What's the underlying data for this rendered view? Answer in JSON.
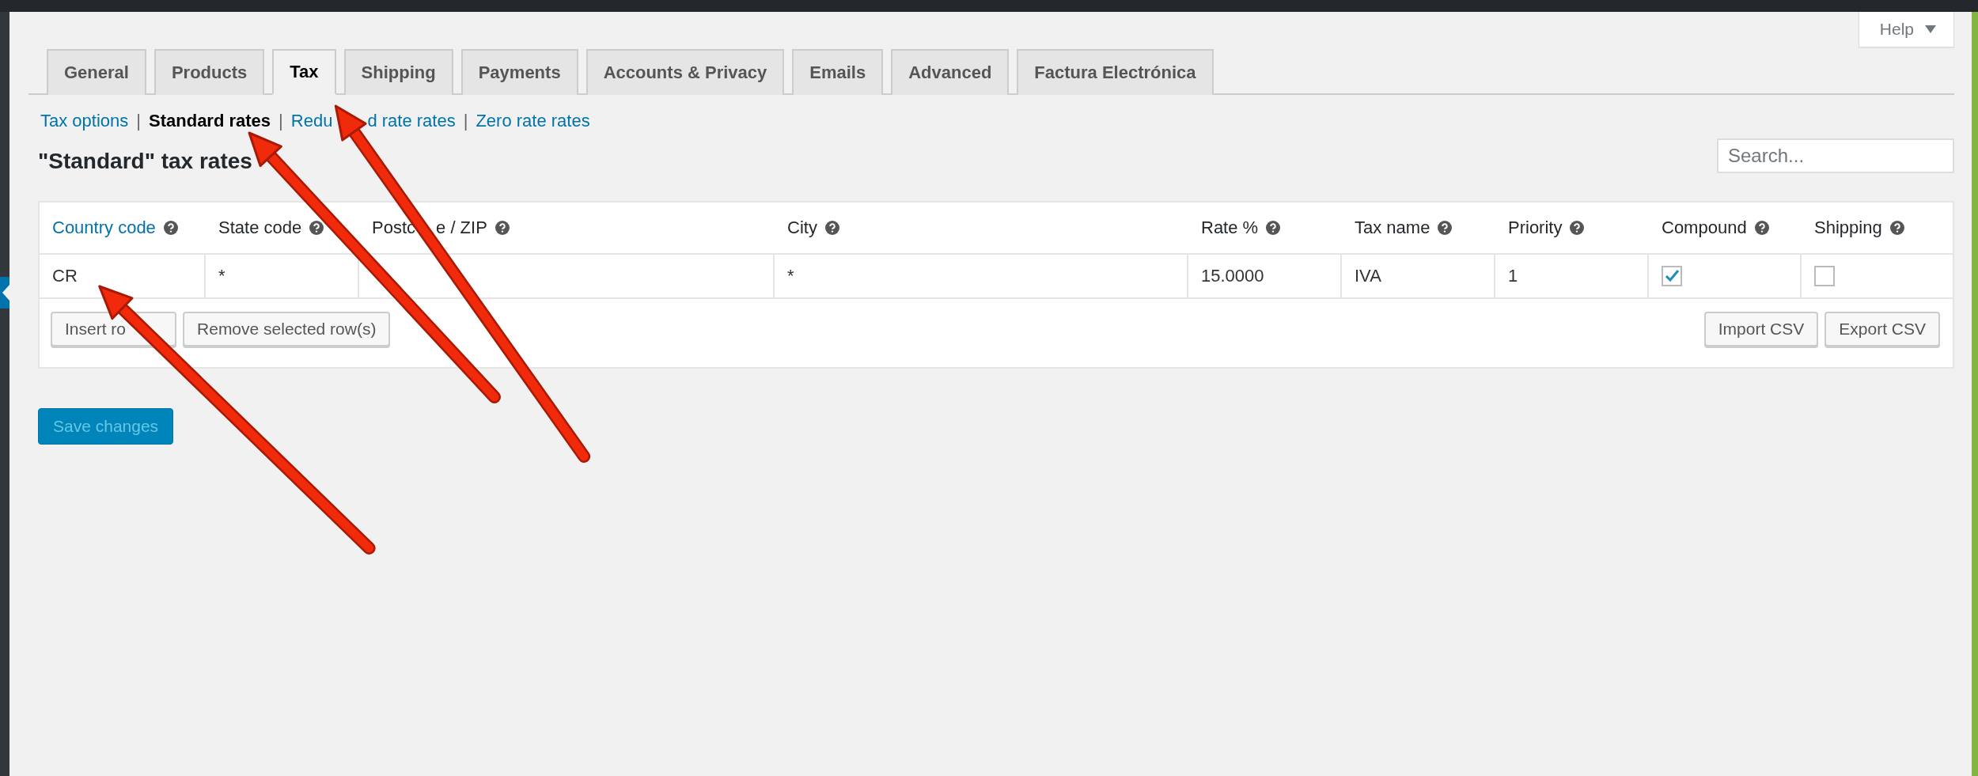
{
  "help_button": {
    "label": "Help"
  },
  "tabs": [
    {
      "label": "General",
      "selected": false
    },
    {
      "label": "Products",
      "selected": false
    },
    {
      "label": "Tax",
      "selected": true
    },
    {
      "label": "Shipping",
      "selected": false
    },
    {
      "label": "Payments",
      "selected": false
    },
    {
      "label": "Accounts & Privacy",
      "selected": false
    },
    {
      "label": "Emails",
      "selected": false
    },
    {
      "label": "Advanced",
      "selected": false
    },
    {
      "label": "Factura Electrónica",
      "selected": false
    }
  ],
  "subnav": [
    {
      "kind": "link",
      "label": "Tax options",
      "selected": false
    },
    {
      "kind": "separator",
      "label": "|"
    },
    {
      "kind": "link",
      "label": "Standard rates",
      "selected": true
    },
    {
      "kind": "separator",
      "label": "|"
    },
    {
      "kind": "link",
      "label": "Redu",
      "label_after_arrow": "d rate rates",
      "selected": false
    },
    {
      "kind": "separator",
      "label": "|"
    },
    {
      "kind": "link",
      "label": "Zero rate rates",
      "selected": false
    }
  ],
  "heading": "\"Standard\" tax rates",
  "search": {
    "placeholder": "Search..."
  },
  "table": {
    "columns": [
      {
        "label": "Country code",
        "kind": "link"
      },
      {
        "label": "State code",
        "kind": "text"
      },
      {
        "label": "Postc",
        "label_after_arrow": "e / ZIP",
        "kind": "text"
      },
      {
        "label": "City",
        "kind": "text"
      },
      {
        "label": "Rate %",
        "kind": "text"
      },
      {
        "label": "Tax name",
        "kind": "text"
      },
      {
        "label": "Priority",
        "kind": "text"
      },
      {
        "label": "Compound",
        "kind": "text"
      },
      {
        "label": "Shipping",
        "kind": "text"
      }
    ],
    "rows": [
      {
        "cells": [
          {
            "kind": "text",
            "value": "CR"
          },
          {
            "kind": "text",
            "value": "*"
          },
          {
            "kind": "text"
          },
          {
            "kind": "text",
            "value": "*"
          },
          {
            "kind": "text",
            "value": "15.0000"
          },
          {
            "kind": "text",
            "value": "IVA"
          },
          {
            "kind": "text",
            "value": "1"
          },
          {
            "kind": "checkbox",
            "checked": true
          },
          {
            "kind": "checkbox",
            "checked": false
          }
        ]
      }
    ],
    "left_buttons": [
      {
        "label": "Insert ro",
        "arrow_over_end": true
      },
      {
        "label": "Remove selected row(s)",
        "arrow_over_end": false
      }
    ],
    "right_buttons": [
      {
        "label": "Import CSV",
        "arrow_over_end": false
      },
      {
        "label": "Export CSV",
        "arrow_over_end": false
      }
    ]
  },
  "save_button": {
    "label": "Save changes",
    "disabled": true
  }
}
